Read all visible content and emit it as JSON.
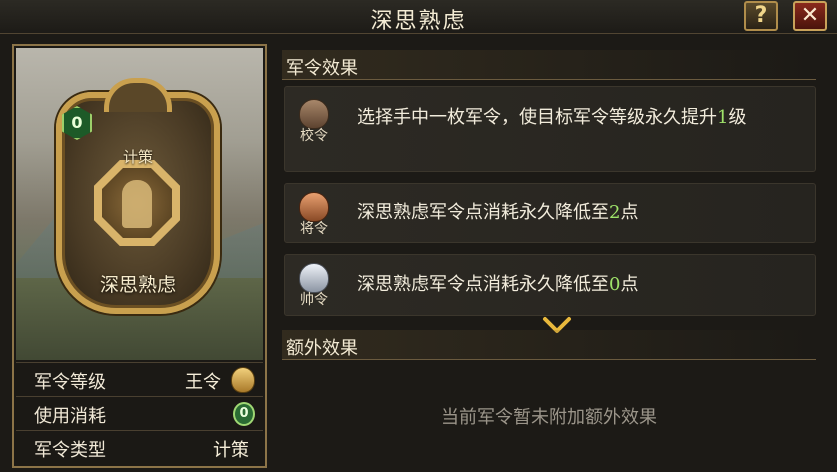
{
  "window": {
    "title": "深思熟虑",
    "help_label": "?",
    "close_label": "✕"
  },
  "card": {
    "type_label": "计策",
    "name_label": "深思熟虑",
    "cost": "0",
    "stats": [
      {
        "label": "军令等级",
        "value": "王令",
        "icon": "gold-token-icon"
      },
      {
        "label": "使用消耗",
        "value": "0",
        "icon": "green-cost-icon"
      },
      {
        "label": "军令类型",
        "value": "计策"
      }
    ]
  },
  "effects": {
    "header": "军令效果",
    "items": [
      {
        "rank": "校令",
        "rank_color": "#8a6a4e",
        "text_pre": "选择手中一枚军令，使目标军令等级永久提升",
        "num": "1",
        "text_post": "级"
      },
      {
        "rank": "将令",
        "rank_color": "#c77a4c",
        "text_pre": "深思熟虑军令点消耗永久降低至",
        "num": "2",
        "text_post": "点"
      },
      {
        "rank": "帅令",
        "rank_color": "#c7ccd4",
        "text_pre": "深思熟虑军令点消耗永久降低至",
        "num": "0",
        "text_post": "点"
      }
    ]
  },
  "extra": {
    "header": "额外效果",
    "empty_text": "当前军令暂未附加额外效果"
  },
  "colors": {
    "accent_gold": "#c9a04e",
    "highlight_green": "#9fe36a"
  }
}
